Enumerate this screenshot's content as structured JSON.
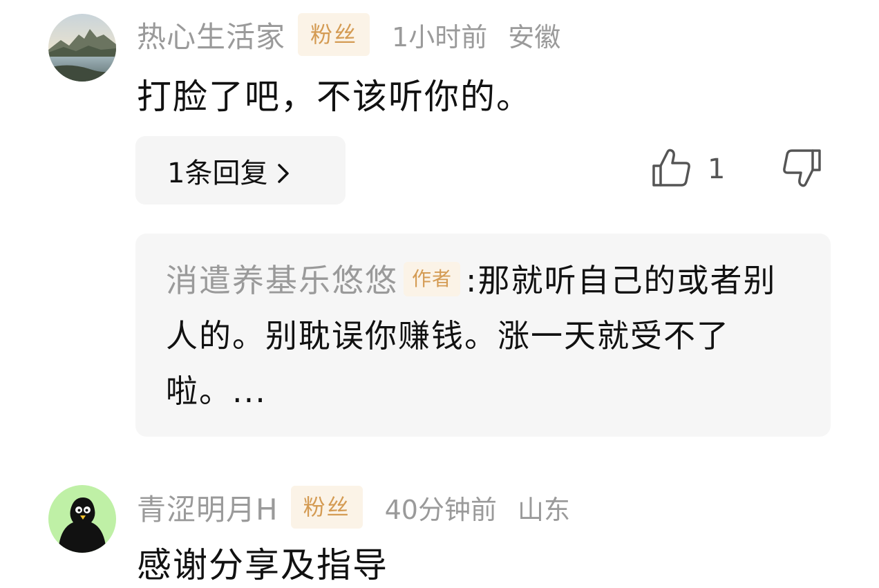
{
  "comments": [
    {
      "username": "热心生活家",
      "badge": "粉丝",
      "time": "1小时前",
      "location": "安徽",
      "content": "打脸了吧，不该听你的。",
      "reply_count_label": "1条回复",
      "like_count": "1",
      "avatar_icon": "landscape-avatar",
      "reply_preview": {
        "username": "消遣养基乐悠悠",
        "badge": "作者",
        "separator": ":",
        "text": "那就听自己的或者别人的。别耽误你赚钱。涨一天就受不了啦。..."
      }
    },
    {
      "username": "青涩明月H",
      "badge": "粉丝",
      "time": "40分钟前",
      "location": "山东",
      "content": "感谢分享及指导",
      "avatar_icon": "penguin-avatar"
    }
  ],
  "icons": {
    "like": "thumbs-up-icon",
    "dislike": "thumbs-down-icon",
    "chevron": "chevron-right-icon"
  },
  "colors": {
    "meta_text": "#9a9a9a",
    "badge_bg": "#fbf3e7",
    "badge_text": "#d49b53",
    "reply_bg": "#f5f5f5",
    "avatar2_bg": "#bff0a6"
  }
}
